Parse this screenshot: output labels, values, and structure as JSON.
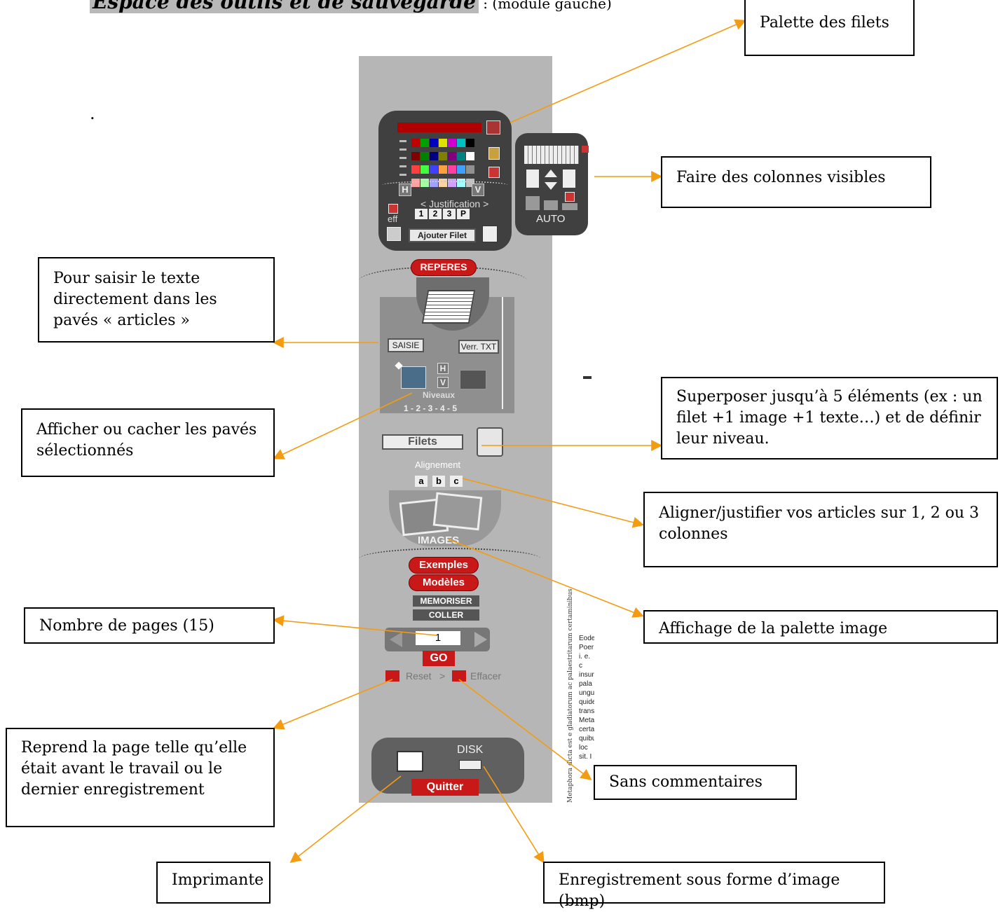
{
  "title": {
    "highlight": "Espace des outils et de sauvegarde",
    "suffix": " : (module gauche)"
  },
  "dot": ".",
  "annotations": {
    "palette": "Palette des filets",
    "colonnes": "Faire des colonnes visibles",
    "saisir": "Pour saisir le texte directement dans les pavés « articles »",
    "afficher": "Afficher ou cacher les pavés sélectionnés",
    "superposer": "Superposer jusqu’à 5 éléments (ex : un filet +1 image +1 texte…) et de définir leur niveau.",
    "aligner": "Aligner/justifier vos articles sur 1, 2 ou 3 colonnes",
    "nombre": "Nombre de pages (15)",
    "affichage": "Affichage de la palette image",
    "reprend": "Reprend la page telle qu’elle était avant le travail ou le dernier enregistrement",
    "sans": "Sans commentaires",
    "imprimante": "Imprimante",
    "enregistrement": "Enregistrement sous forme d’image (bmp)"
  },
  "panel": {
    "h": "H",
    "v": "V",
    "justification": "< Justification >",
    "just_buttons": [
      "1",
      "2",
      "3",
      "P"
    ],
    "eff": "eff",
    "ajouter_filet": "Ajouter Filet",
    "auto": "AUTO",
    "reperes": "REPERES",
    "saisie": "SAISIE",
    "verr_txt": "Verr. TXT",
    "niveaux": "Niveaux",
    "niveaux_nums": "1 - 2 - 3 - 4 - 5",
    "filets": "Filets",
    "alignement": "Alignement",
    "align_buttons": [
      "a",
      "b",
      "c"
    ],
    "images": "IMAGES",
    "exemples": "Exemples",
    "modeles": "Modèles",
    "memoriser": "MEMORISER",
    "coller": "COLLER",
    "page_value": "1",
    "go": "GO",
    "reset": "Reset",
    "gt": ">",
    "effacer": "Effacer",
    "disk": "DISK",
    "quitter": "Quitter"
  },
  "sidetext": {
    "vertical": "Metaphora dicta est e gladiatorum ac palaestritarum certaminibus.",
    "lines": [
      "Eode",
      "Poer",
      "i. e. c",
      "insur",
      "pala",
      "ungu",
      "quide",
      "trans",
      "Meta",
      "certa",
      "quibu",
      "loc",
      "sit. I"
    ]
  },
  "swatch_colors": [
    [
      "#c00000",
      "#00a000",
      "#0000c0",
      "#e0e000",
      "#d000d0",
      "#00c0c0",
      "#000000"
    ],
    [
      "#800000",
      "#008000",
      "#000080",
      "#808000",
      "#800080",
      "#008080",
      "#ffffff"
    ],
    [
      "#ff4040",
      "#40ff40",
      "#4040ff",
      "#ffa040",
      "#ff40a0",
      "#40a0ff",
      "#909090"
    ],
    [
      "#ffa0a0",
      "#a0ffa0",
      "#a0a0ff",
      "#ffd0a0",
      "#d0a0ff",
      "#a0ffff",
      "#c0c0c0"
    ]
  ]
}
